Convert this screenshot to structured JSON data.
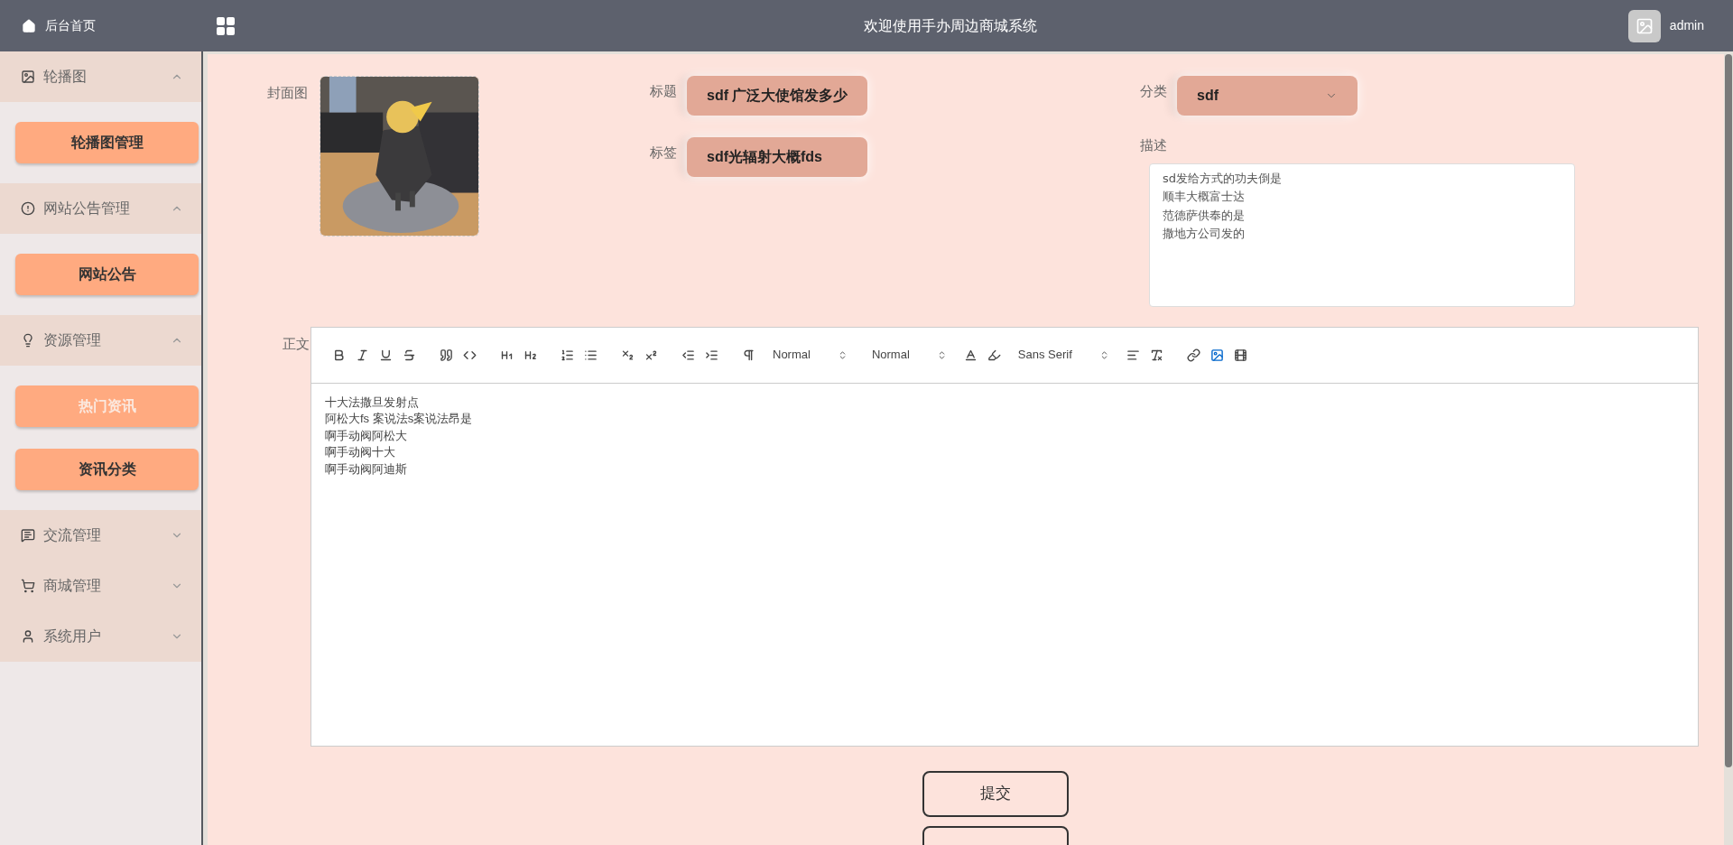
{
  "header": {
    "home_label": "后台首页",
    "title": "欢迎使用手办周边商城系统",
    "user": "admin"
  },
  "sidebar": {
    "groups": [
      {
        "label": "轮播图",
        "expanded": true,
        "items": [
          {
            "label": "轮播图管理",
            "selected": false
          }
        ]
      },
      {
        "label": "网站公告管理",
        "expanded": true,
        "items": [
          {
            "label": "网站公告",
            "selected": false
          }
        ]
      },
      {
        "label": "资源管理",
        "expanded": true,
        "items": [
          {
            "label": "热门资讯",
            "selected": true
          },
          {
            "label": "资讯分类",
            "selected": false
          }
        ]
      },
      {
        "label": "交流管理",
        "expanded": false
      },
      {
        "label": "商城管理",
        "expanded": false
      },
      {
        "label": "系统用户",
        "expanded": false
      }
    ]
  },
  "form": {
    "cover": {
      "label": "封面图",
      "kind": "picture"
    },
    "title": {
      "label": "标题",
      "value": "sdf 广泛大使馆发多少"
    },
    "tags": {
      "label": "标签",
      "value": "sdf光辐射大概fds"
    },
    "category": {
      "label": "分类",
      "value": "sdf"
    },
    "description": {
      "label": "描述",
      "lines": [
        "sd发给方式的功夫倒是",
        "顺丰大概富士达",
        "范德萨供奉的是",
        "撒地方公司发的"
      ]
    },
    "body": {
      "label": "正文",
      "toolbar": {
        "header_select": "Normal",
        "size_select": "Normal",
        "font_select": "Sans Serif",
        "image_hovered": true
      },
      "lines": [
        "十大法撒旦发射点",
        "阿松大fs 案说法s案说法昂是",
        "啊手动阀阿松大",
        "啊手动阀十大",
        "啊手动阀阿迪斯"
      ]
    }
  },
  "buttons": [
    "提交"
  ]
}
